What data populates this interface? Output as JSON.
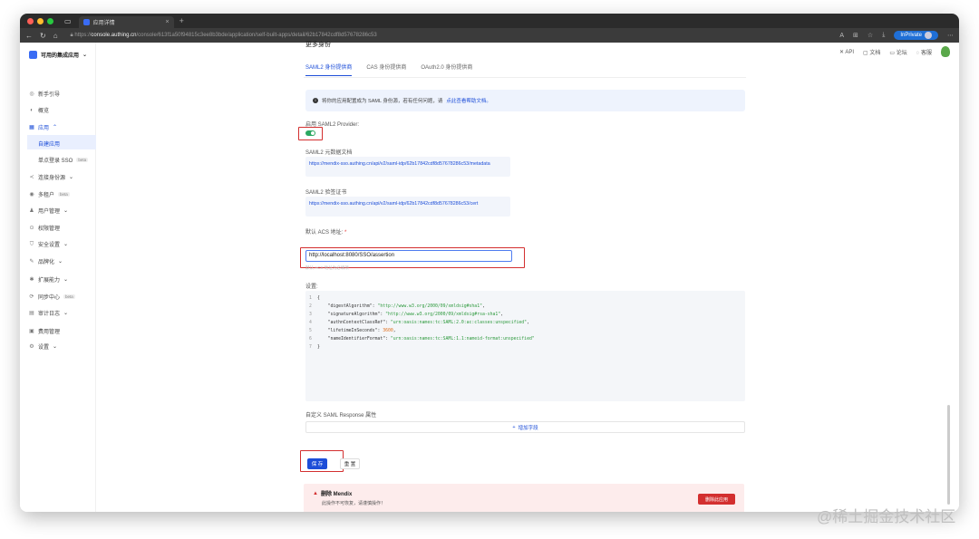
{
  "browser": {
    "tab_title": "应用详情",
    "url_prefix": "https://",
    "url_host": "console.authing.cn",
    "url_path": "/console/613f1a50f94815c3ee8b3bde/application/self-built-apps/detail/62b17842cdf8d57678286c53",
    "inprivate": "InPrivate"
  },
  "header_links": {
    "api": "API",
    "docs": "文档",
    "forum": "论坛",
    "service": "客服"
  },
  "sidebar": {
    "selector": "可用的集成应用",
    "items": [
      "新手引导",
      "概览",
      "应用",
      "自建应用",
      "单点登录 SSO",
      "连接身份源",
      "多租户",
      "用户管理",
      "权限管理",
      "安全设置",
      "品牌化",
      "扩展能力",
      "同步中心",
      "审计日志",
      "费用管理",
      "设置"
    ],
    "beta": "beta"
  },
  "content": {
    "section_title": "更多身份",
    "tabs": [
      "SAML2 身份提供商",
      "CAS 身份提供商",
      "OAuth2.0 身份提供商"
    ],
    "notice_text": "将你的应用配置成为 SAML 身份源，若有任何问题，请",
    "notice_link": "点此查看帮助文档。",
    "enable_label": "启用 SAML2 Provider:",
    "metadata_label": "SAML2 元数据文档",
    "metadata_url": "https://mendix-sso.authing.cn/api/v2/saml-idp/62b17842cdf8d57678286c53/metadata",
    "cert_label": "SAML2 验签证书",
    "cert_url": "https://mendix-sso.authing.cn/api/v2/saml-idp/62b17842cdf8d57678286c53/cert",
    "acs_label": "默认 ACS 地址:",
    "acs_value": "http://localhost:8080/SSO/assertion",
    "acs_hint": "默认 ACS 地址为必填项",
    "settings_label": "设置:",
    "custom_label": "自定义 SAML Response 属性",
    "add_field": "增加字段",
    "save": "保 存",
    "reset": "重 置",
    "danger_title": "删除 Mendix",
    "danger_desc": "此操作不可恢复，请谨慎操作！",
    "danger_button": "删除此应用"
  },
  "code": {
    "line1": "{",
    "l2k": "\"digestAlgorithm\"",
    "l2v": "\"http://www.w3.org/2000/09/xmldsig#sha1\"",
    "l3k": "\"signatureAlgorithm\"",
    "l3v": "\"http://www.w3.org/2000/09/xmldsig#rsa-sha1\"",
    "l4k": "\"authnContextClassRef\"",
    "l4v": "\"urn:oasis:names:tc:SAML:2.0:ac:classes:unspecified\"",
    "l5k": "\"lifetimeInSeconds\"",
    "l5v": "3600",
    "l6k": "\"nameIdentifierFormat\"",
    "l6v": "\"urn:oasis:names:tc:SAML:1.1:nameid-format:unspecified\"",
    "line7": "}"
  },
  "watermark": "@稀土掘金技术社区"
}
